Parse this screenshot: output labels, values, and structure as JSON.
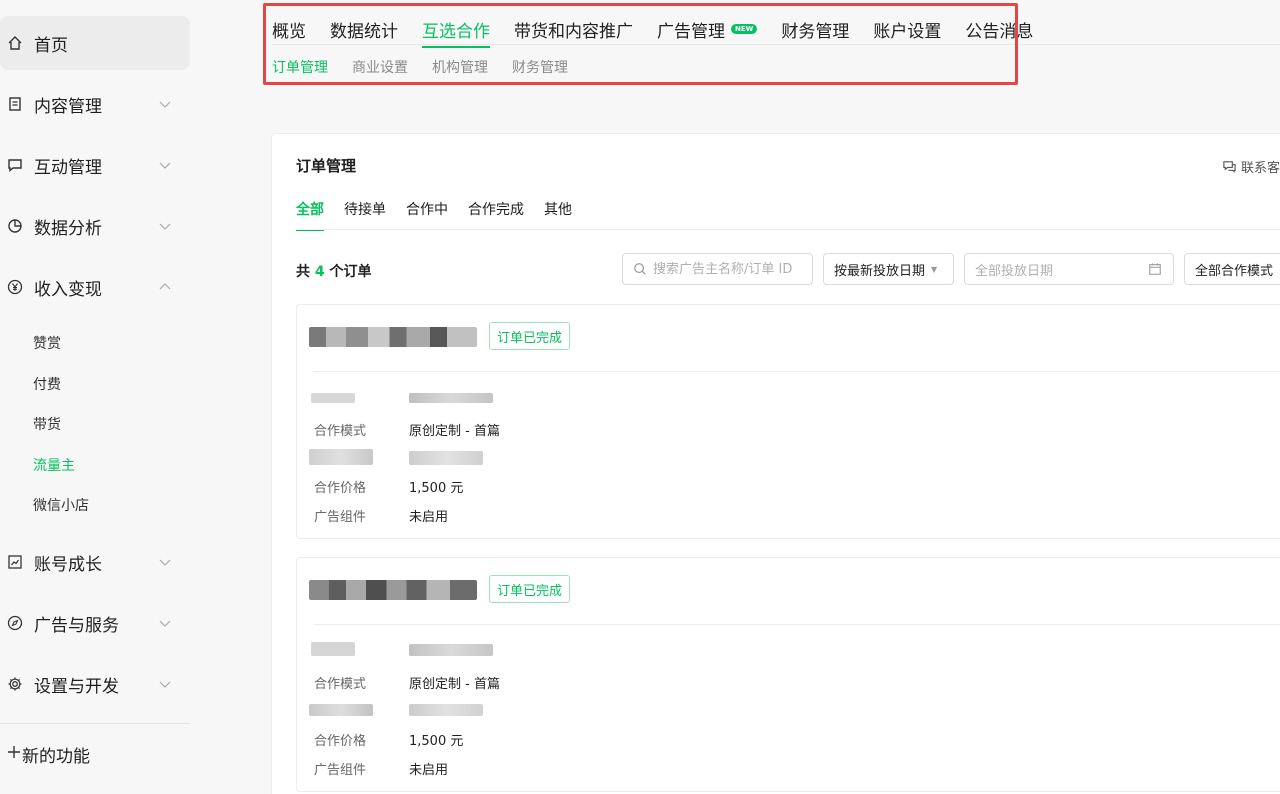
{
  "sidebar": {
    "items": [
      {
        "label": "首页",
        "icon": "home-icon"
      },
      {
        "label": "内容管理",
        "icon": "document-icon"
      },
      {
        "label": "互动管理",
        "icon": "comment-icon"
      },
      {
        "label": "数据分析",
        "icon": "pie-chart-icon"
      },
      {
        "label": "收入变现",
        "icon": "yen-icon"
      },
      {
        "label": "账号成长",
        "icon": "trend-icon"
      },
      {
        "label": "广告与服务",
        "icon": "compass-icon"
      },
      {
        "label": "设置与开发",
        "icon": "gear-icon"
      }
    ],
    "income_sub": [
      "赞赏",
      "付费",
      "带货",
      "流量主",
      "微信小店"
    ],
    "new_feature": "新的功能"
  },
  "top_tabs": [
    "概览",
    "数据统计",
    "互选合作",
    "带货和内容推广",
    "广告管理",
    "财务管理",
    "账户设置",
    "公告消息"
  ],
  "new_badge": "NEW",
  "sub_tabs": [
    "订单管理",
    "商业设置",
    "机构管理",
    "财务管理"
  ],
  "card": {
    "title": "订单管理",
    "contact": "联系客"
  },
  "status_tabs": [
    "全部",
    "待接单",
    "合作中",
    "合作完成",
    "其他"
  ],
  "total": {
    "prefix": "共",
    "count": "4",
    "suffix": "个订单"
  },
  "filters": {
    "search_placeholder": "搜索广告主名称/订单 ID",
    "sort": "按最新投放日期",
    "date_placeholder": "全部投放日期",
    "mode": "全部合作模式"
  },
  "orders": [
    {
      "status": "订单已完成",
      "mode_label": "合作模式",
      "mode_value": "原创定制 - 首篇",
      "price_label": "合作价格",
      "price_value": "1,500 元",
      "ad_label": "广告组件",
      "ad_value": "未启用"
    },
    {
      "status": "订单已完成",
      "mode_label": "合作模式",
      "mode_value": "原创定制 - 首篇",
      "price_label": "合作价格",
      "price_value": "1,500 元",
      "ad_label": "广告组件",
      "ad_value": "未启用"
    }
  ],
  "colors": {
    "accent": "#07c160",
    "highlight": "#e64545"
  }
}
